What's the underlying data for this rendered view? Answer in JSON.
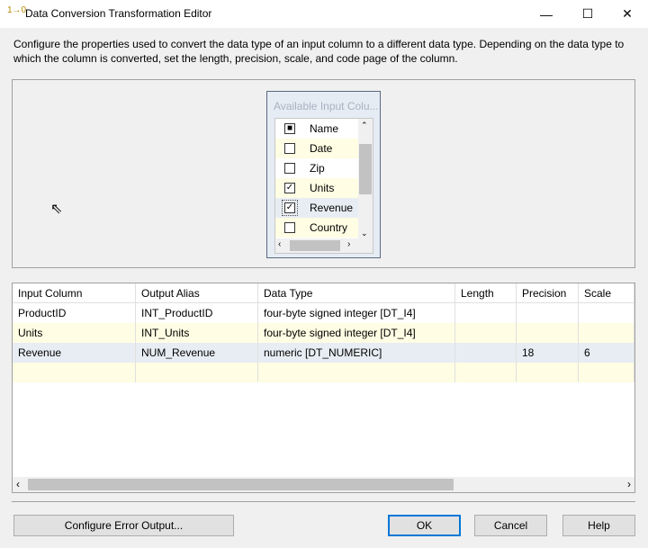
{
  "window": {
    "title": "Data Conversion Transformation Editor",
    "minimize": "—",
    "maximize": "☐",
    "close": "✕"
  },
  "description": "Configure the properties used to convert the data type of an input column to a different data type. Depending on the data type to which the column is converted, set the length, precision, scale, and code page of the column.",
  "columns_box": {
    "title": "Available Input Colu...",
    "header": "Name",
    "items": [
      {
        "label": "Date",
        "checked": false
      },
      {
        "label": "Zip",
        "checked": false
      },
      {
        "label": "Units",
        "checked": true
      },
      {
        "label": "Revenue",
        "checked": true
      },
      {
        "label": "Country",
        "checked": false
      }
    ]
  },
  "grid": {
    "headers": [
      "Input Column",
      "Output Alias",
      "Data Type",
      "Length",
      "Precision",
      "Scale"
    ],
    "rows": [
      [
        "ProductID",
        "INT_ProductID",
        "four-byte signed integer [DT_I4]",
        "",
        "",
        ""
      ],
      [
        "Units",
        "INT_Units",
        "four-byte signed integer [DT_I4]",
        "",
        "",
        ""
      ],
      [
        "Revenue",
        "NUM_Revenue",
        "numeric [DT_NUMERIC]",
        "",
        "18",
        "6"
      ],
      [
        "",
        "",
        "",
        "",
        "",
        ""
      ]
    ]
  },
  "buttons": {
    "configure_error": "Configure Error Output...",
    "ok": "OK",
    "cancel": "Cancel",
    "help": "Help"
  },
  "colors": {
    "alt_row": "#fffde3",
    "selected_row": "#e8edf3",
    "ok_border": "#0078d7"
  }
}
